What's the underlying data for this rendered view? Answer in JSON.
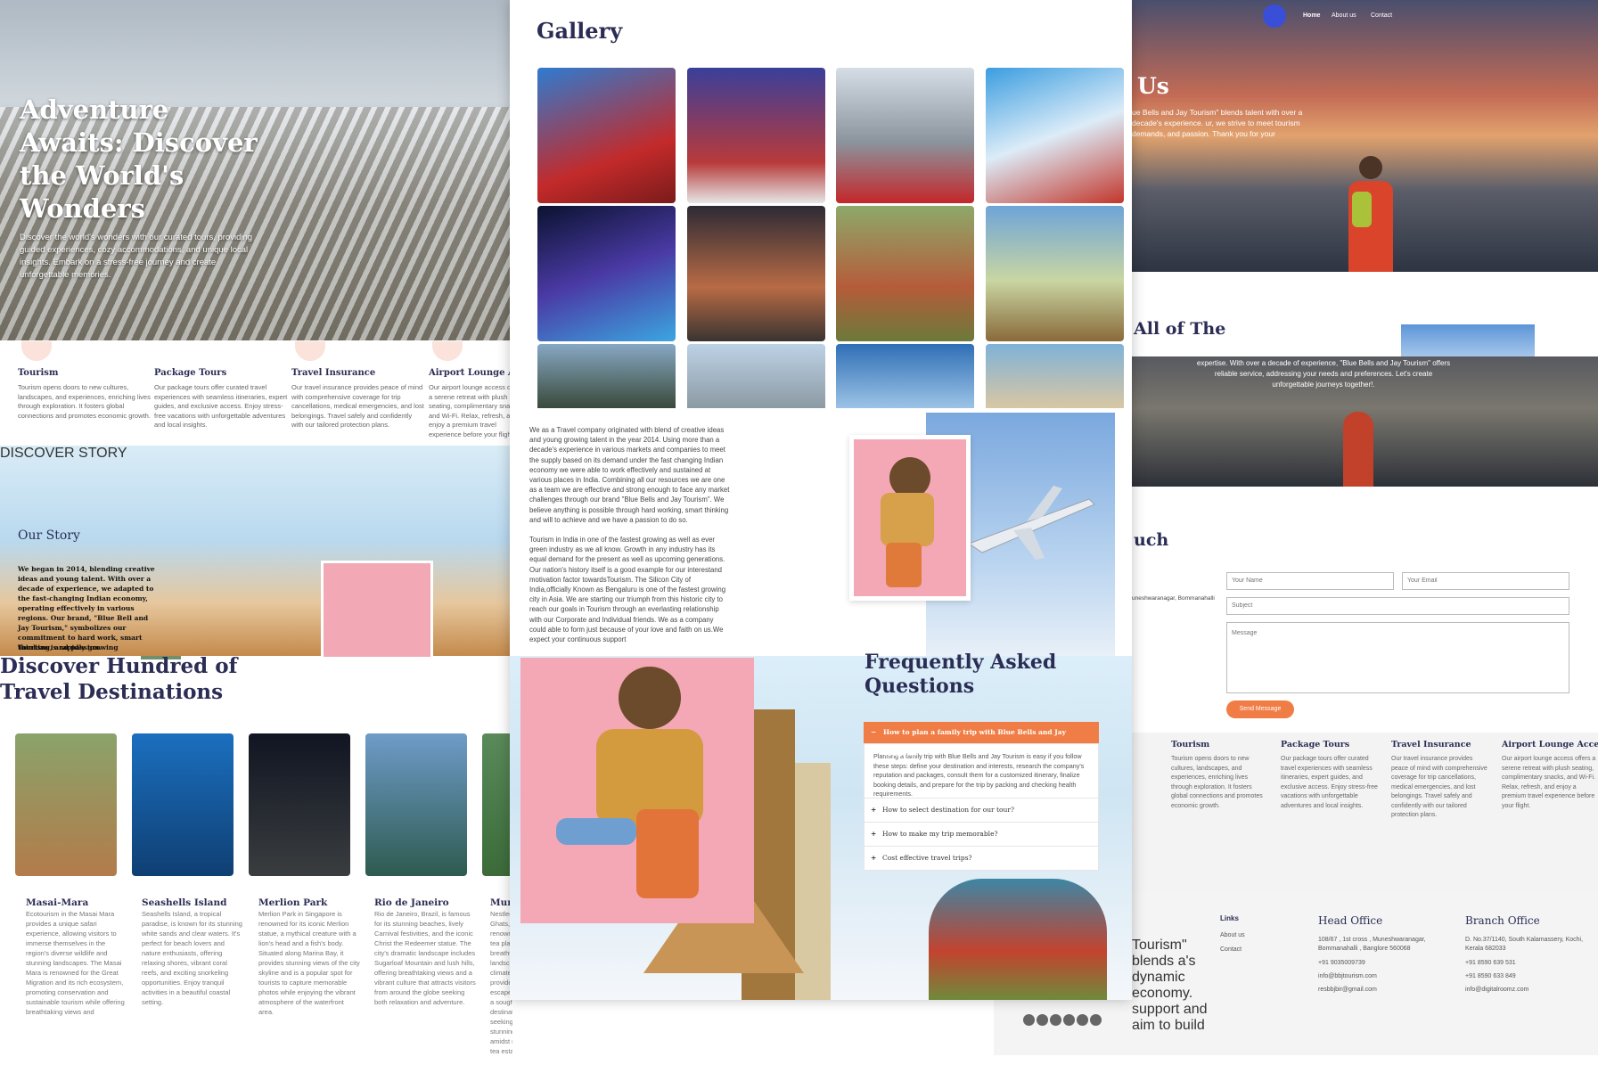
{
  "left": {
    "hero_title": "Adventure Awaits: Discover the World's Wonders",
    "hero_text": "Discover the world's wonders with our curated tours, providing guided experiences, cozy accommodations, and unique local insights. Embark on a stress-free journey and create unforgettable memories.",
    "services": [
      {
        "title": "Tourism",
        "text": "Tourism opens doors to new cultures, landscapes, and experiences, enriching lives through exploration. It fosters global connections and promotes economic growth."
      },
      {
        "title": "Package Tours",
        "text": "Our package tours offer curated travel experiences with seamless itineraries, expert guides, and exclusive access. Enjoy stress-free vacations with unforgettable adventures and local insights."
      },
      {
        "title": "Travel Insurance",
        "text": "Our travel insurance provides peace of mind with comprehensive coverage for trip cancellations, medical emergencies, and lost belongings. Travel safely and confidently with our tailored protection plans."
      },
      {
        "title": "Airport Lounge Acce",
        "text": "Our airport lounge access offers a serene retreat with plush seating, complimentary snacks, and Wi-Fi. Relax, refresh, and enjoy a premium travel experience before your flight."
      }
    ],
    "story_kicker": "DISCOVER STORY",
    "story_title": "Our Story",
    "story_text": "We began in 2014, blending creative ideas and young talent. With over a decade of experience, we adapted to the fast-changing Indian economy, operating effectively in various regions. Our brand, \"Blue Bell and Jay Tourism,\" symbolizes our commitment to hard work, smart thinking, and passion.",
    "story_text_2": "Tourism is rapidly growing",
    "dest_title": "Discover Hundred of Travel Destinations",
    "destinations": [
      {
        "name": "Masai-Mara",
        "text": "Ecotourism in the Masai Mara provides a unique safari experience, allowing visitors to immerse themselves in the region's diverse wildlife and stunning landscapes. The Masai Mara is renowned for the Great Migration and its rich ecosystem, promoting conservation and sustainable tourism while offering breathtaking views and"
      },
      {
        "name": "Seashells Island",
        "text": "Seashells Island, a tropical paradise, is known for its stunning white sands and clear waters. It's perfect for beach lovers and nature enthusiasts, offering relaxing shores, vibrant coral reefs, and exciting snorkeling opportunities. Enjoy tranquil activities in a beautiful coastal setting."
      },
      {
        "name": "Merlion Park",
        "text": "Merlion Park in Singapore is renowned for its iconic Merlion statue, a mythical creature with a lion's head and a fish's body. Situated along Marina Bay, it provides stunning views of the city skyline and is a popular spot for tourists to capture memorable photos while enjoying the vibrant atmosphere of the waterfront area."
      },
      {
        "name": "Rio de Janeiro",
        "text": "Rio de Janeiro, Brazil, is famous for its stunning beaches, lively Carnival festivities, and the iconic Christ the Redeemer statue. The city's dramatic landscape includes Sugarloaf Mountain and lush hills, offering breathtaking views and a vibrant culture that attracts visitors from around the globe seeking both relaxation and adventure."
      },
      {
        "name": "Mun",
        "text": "Nestled in the Western Ghats, Munnar is renowned for its vast tea plantations and breathtaking landscapes with a cool climate, misty hills and provides an ideal escape into nature. It's a sought-after destination for travelers seeking tranquility and stunning natural beauty amidst rolling hills and tea estates."
      }
    ]
  },
  "center": {
    "gallery_title": "Gallery",
    "about_p1": "We as a Travel company originated with blend of creative ideas and young growing talent in the year 2014. Using more than a decade's experience in various markets and companies to meet the supply based on its demand under the fast changing Indian economy we were able to work effectively and sustained at various places in India. Combining all our resources we are one as a team we are effective and strong enough to face any market challenges through our brand \"Blue Bells and Jay Tourism\". We believe anything is possible through hard working, smart thinking and will to achieve and we have a passion to do so.",
    "about_p2": "Tourism in India in one of the fastest growing as well as ever green industry as we all know. Growth in any industry has its equal demand for the present as well as upcoming generations. Our nation's history itself is a good example for our interestand motivation factor towardsTourism. The Silicon City of India,officially Known as Bengaluru is one of the fastest growing city in Asia. We are starting our triumph from this historic city to reach our goals in Tourism through an everlasting relationship with our Corporate and Individual friends. We as a company could able to form just because of your love and faith on us.We expect your continuous support",
    "faq_title": "Frequently Asked Questions",
    "faq_open_q": "How to plan a family trip with Blue Bells and Jay Tourism?",
    "faq_open_a": "Planning a family trip with Blue Bells and Jay Tourism is easy if you follow these steps: define your destination and interests, research the company's reputation and packages, consult them for a customized itinerary, finalize booking details, and prepare for the trip by packing and checking health requirements.",
    "faq_items": [
      "How to select destination for our tour?",
      "How to make my trip memorable?",
      "Cost effective travel trips?"
    ]
  },
  "right": {
    "nav": [
      "Home",
      "About us",
      "Contact"
    ],
    "hero_title": "Us",
    "hero_text": "ue Bells and Jay Tourism\" blends talent with over a decade's experience. ur, we strive to meet tourism demands, and passion. Thank you for your",
    "all_title": "All of The",
    "strip_text": "expertise. With over a decade of experience, \"Blue Bells and Jay Tourism\" offers reliable service, addressing your needs and preferences. Let's create unforgettable journeys together!.",
    "touch_title": "uch",
    "address": "uneshwaranagar, Bommanahalli",
    "form": {
      "name_ph": "Your Name",
      "email_ph": "Your Email",
      "subject_ph": "Subject",
      "message_ph": "Message",
      "send": "Send Message"
    },
    "services": [
      {
        "title": "Tourism",
        "text": "Tourism opens doors to new cultures, landscapes, and experiences, enriching lives through exploration. It fosters global connections and promotes economic growth."
      },
      {
        "title": "Package Tours",
        "text": "Our package tours offer curated travel experiences with seamless itineraries, expert guides, and exclusive access. Enjoy stress-free vacations with unforgettable adventures and local insights."
      },
      {
        "title": "Travel Insurance",
        "text": "Our travel insurance provides peace of mind with comprehensive coverage for trip cancellations, medical emergencies, and lost belongings. Travel safely and confidently with our tailored protection plans."
      },
      {
        "title": "Airport Lounge Access",
        "text": "Our airport lounge access offers a serene retreat with plush seating, complimentary snacks, and Wi-Fi. Relax, refresh, and enjoy a premium travel experience before your flight."
      }
    ],
    "footer": {
      "about_text": "Tourism\" blends a's dynamic economy. support and aim to build",
      "links_title": "Links",
      "links": [
        "About us",
        "Contact"
      ],
      "head_title": "Head Office",
      "head_lines": [
        "108/67 , 1st cross , Muneshwaranagar,",
        "Bommanahalli , Banglore 560068",
        "+91 9035009739",
        "info@bbjtourism.com",
        "resbbjbir@gmail.com"
      ],
      "branch_title": "Branch Office",
      "branch_lines": [
        "D. No.37/1140, South Kalamassery, Kochi,",
        "Kerala 682033",
        "+91 8590 639 531",
        "+91 8590 633 849",
        "info@digitalroomz.com"
      ]
    }
  }
}
